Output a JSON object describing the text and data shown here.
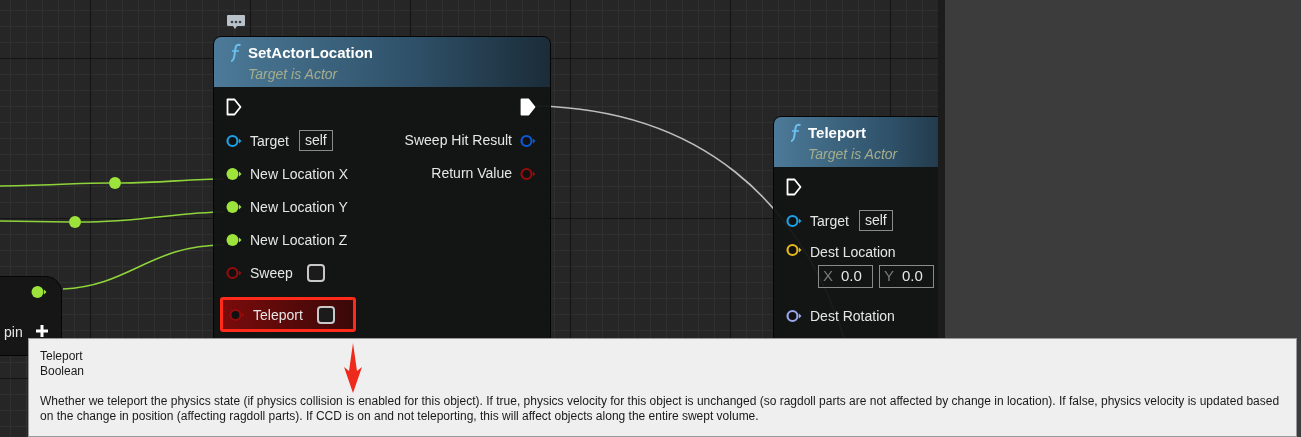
{
  "canvas": {
    "nodes": [
      {
        "title": "SetActorLocation",
        "subtitle": "Target is Actor",
        "exec_in": {
          "connected": false
        },
        "exec_out": {
          "connected": true
        },
        "inputs": [
          {
            "label": "Target",
            "kind": "object",
            "connected": false,
            "default": "self"
          },
          {
            "label": "New Location X",
            "kind": "float",
            "connected": true
          },
          {
            "label": "New Location Y",
            "kind": "float",
            "connected": true
          },
          {
            "label": "New Location Z",
            "kind": "float",
            "connected": true
          },
          {
            "label": "Sweep",
            "kind": "bool",
            "connected": false,
            "checked": false,
            "highlighted": false
          },
          {
            "label": "Teleport",
            "kind": "bool",
            "connected": false,
            "checked": false,
            "highlighted": true
          }
        ],
        "outputs": [
          {
            "label": "Sweep Hit Result",
            "kind": "struct",
            "connected": false
          },
          {
            "label": "Return Value",
            "kind": "bool",
            "connected": false
          }
        ]
      },
      {
        "title": "Teleport",
        "subtitle": "Target is Actor",
        "exec_in": {
          "connected": false
        },
        "inputs": [
          {
            "label": "Target",
            "kind": "object",
            "connected": false,
            "default": "self"
          },
          {
            "label": "Dest Location",
            "kind": "vector",
            "connected": false,
            "fields": [
              {
                "axis": "X",
                "value": "0.0"
              },
              {
                "axis": "Y",
                "value": "0.0"
              }
            ]
          },
          {
            "label": "Dest Rotation",
            "kind": "rotator",
            "connected": false
          }
        ]
      }
    ],
    "partial_node": {
      "label": "pin"
    }
  },
  "tooltip": {
    "title": "Teleport",
    "type": "Boolean",
    "description": "Whether we teleport the physics state (if physics collision is enabled for this object). If true, physics velocity for this object is unchanged (so ragdoll parts are not affected by change in location). If false, physics velocity is updated based on the change in position (affecting ragdoll parts). If CCD is on and not teleporting, this will affect objects along the entire swept volume."
  }
}
